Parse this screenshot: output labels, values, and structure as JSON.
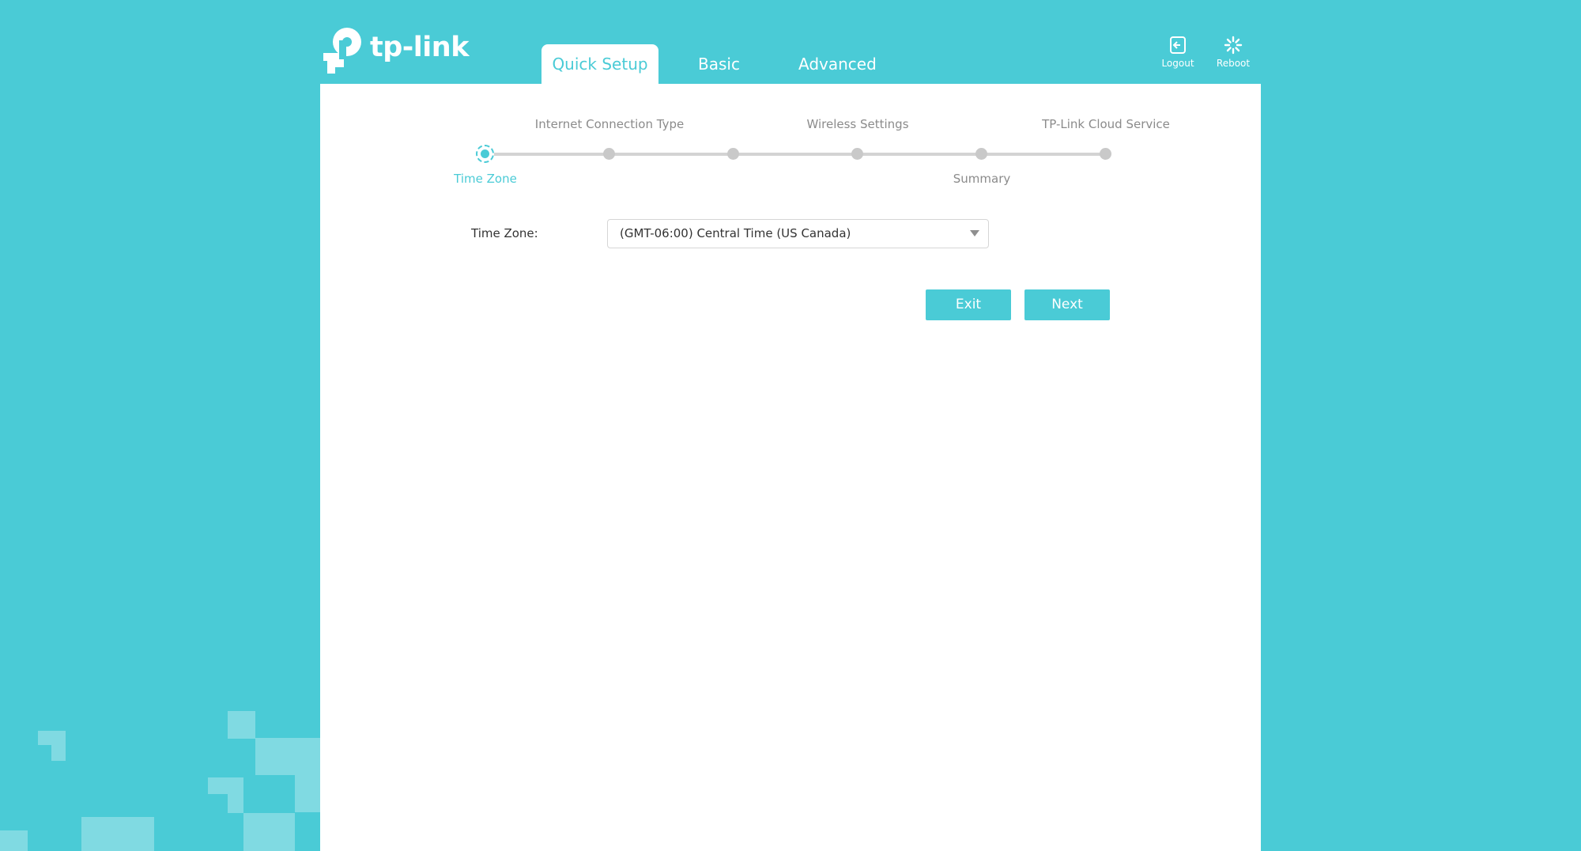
{
  "header": {
    "brand": "tp-link",
    "tabs": [
      {
        "label": "Quick Setup",
        "active": true
      },
      {
        "label": "Basic",
        "active": false
      },
      {
        "label": "Advanced",
        "active": false
      }
    ],
    "tools": [
      {
        "label": "Logout",
        "icon": "logout-icon"
      },
      {
        "label": "Reboot",
        "icon": "reboot-icon"
      }
    ]
  },
  "stepper": {
    "steps": [
      {
        "label": "Time Zone",
        "state": "active"
      },
      {
        "label": "Internet Connection Type",
        "state": "pending"
      },
      {
        "label": "",
        "state": "pending"
      },
      {
        "label": "Wireless Settings",
        "state": "pending"
      },
      {
        "label": "Summary",
        "state": "pending"
      },
      {
        "label": "TP-Link Cloud Service",
        "state": "pending"
      }
    ]
  },
  "form": {
    "time_zone_label": "Time Zone:",
    "time_zone_value": "(GMT-06:00) Central Time (US Canada)"
  },
  "actions": {
    "exit_label": "Exit",
    "next_label": "Next"
  },
  "colors": {
    "accent": "#4acbd6",
    "panel": "#ffffff",
    "muted_text": "#8b8b8b"
  }
}
